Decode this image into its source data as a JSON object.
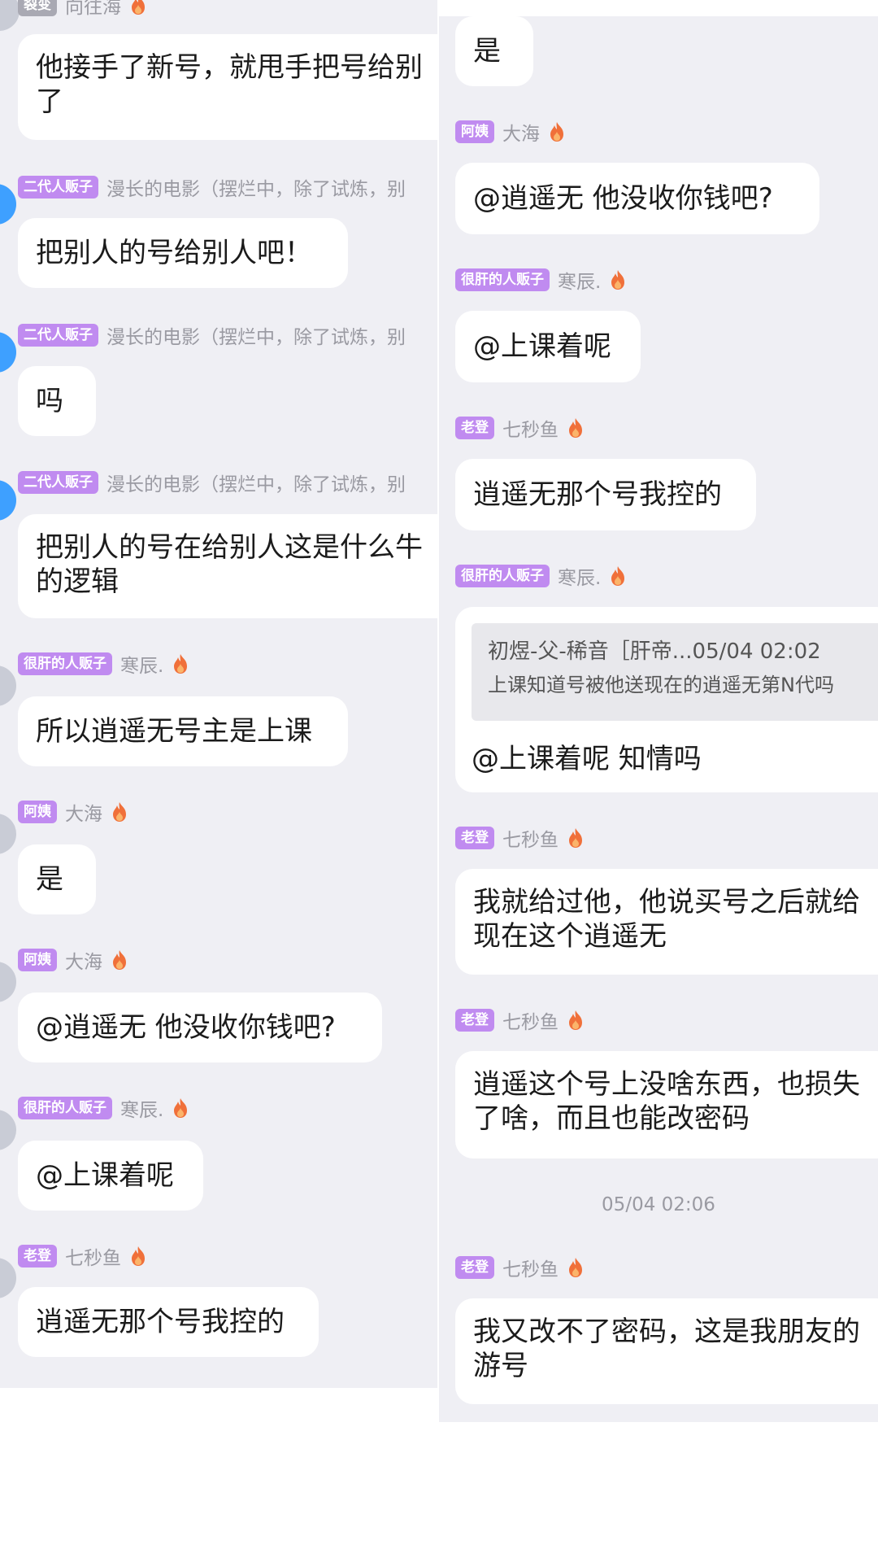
{
  "left": {
    "top_badge": "裂变",
    "top_user": "向往海",
    "messages": [
      {
        "line1": "他接手了新号，就甩手把号给别",
        "line2": "了"
      },
      {
        "badge": "二代人贩子",
        "user": "漫长的电影（摆烂中，除了试炼，别",
        "text": "把别人的号给别人吧！"
      },
      {
        "badge": "二代人贩子",
        "user": "漫长的电影（摆烂中，除了试炼，别",
        "text": "吗"
      },
      {
        "badge": "二代人贩子",
        "user": "漫长的电影（摆烂中，除了试炼，别",
        "line1": "把别人的号在给别人这是什么牛",
        "line2": "的逻辑"
      },
      {
        "badge": "很肝的人贩子",
        "user": "寒辰.",
        "text": "所以逍遥无号主是上课"
      },
      {
        "badge": "阿姨",
        "user": "大海",
        "text": "是"
      },
      {
        "badge": "阿姨",
        "user": "大海",
        "text": "@逍遥无 他没收你钱吧?"
      },
      {
        "badge": "很肝的人贩子",
        "user": "寒辰.",
        "text": "@上课着呢"
      },
      {
        "badge": "老登",
        "user": "七秒鱼",
        "text": "逍遥无那个号我控的"
      }
    ]
  },
  "right": {
    "messages": [
      {
        "text": "是"
      },
      {
        "badge": "阿姨",
        "user": "大海",
        "text": "@逍遥无 他没收你钱吧?"
      },
      {
        "badge": "很肝的人贩子",
        "user": "寒辰.",
        "text": "@上课着呢"
      },
      {
        "badge": "老登",
        "user": "七秒鱼",
        "text": "逍遥无那个号我控的"
      },
      {
        "badge": "很肝的人贩子",
        "user": "寒辰.",
        "quote_line1": "初煜-父-稀音［肝帝...05/04 02:02",
        "quote_line2": "上课知道号被他送现在的逍遥无第N代吗",
        "text": "@上课着呢 知情吗"
      },
      {
        "badge": "老登",
        "user": "七秒鱼",
        "line1": "我就给过他，他说买号之后就给",
        "line2": "现在这个逍遥无"
      },
      {
        "badge": "老登",
        "user": "七秒鱼",
        "line1": "逍遥这个号上没啥东西，也损失",
        "line2": "了啥，而且也能改密码"
      },
      {
        "badge": "老登",
        "user": "七秒鱼",
        "line1": "我又改不了密码，这是我朋友的",
        "line2": "游号"
      }
    ],
    "timestamp": "05/04 02:06"
  },
  "colors": {
    "badge_bg": "#c08bf0",
    "chat_bg": "#efeff4",
    "bubble_bg": "#ffffff",
    "name_text": "#9a9aa2",
    "flame": "#f0703a"
  }
}
